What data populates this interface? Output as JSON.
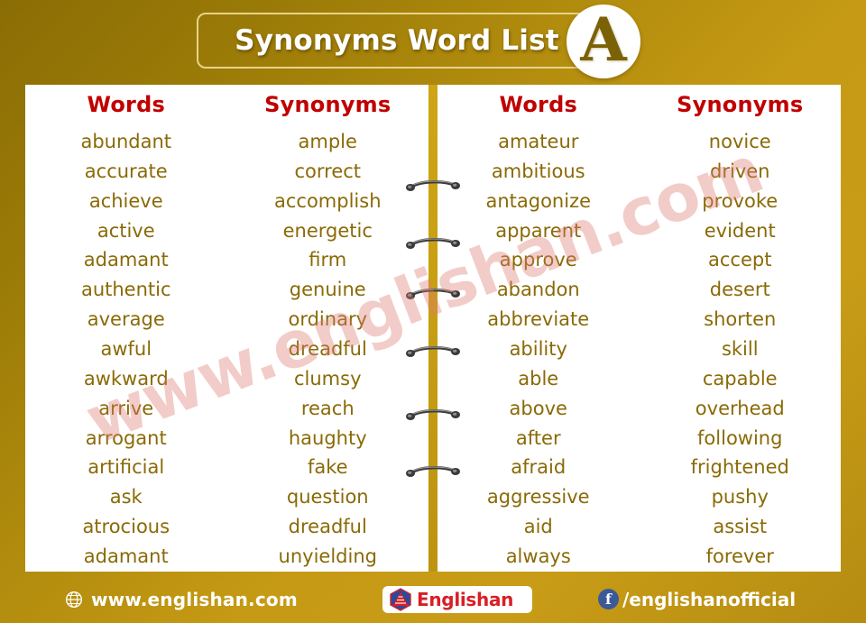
{
  "header": {
    "title": "Synonyms Word List",
    "letter_badge": "A"
  },
  "pages": [
    {
      "id": "left-page",
      "columns": [
        {
          "header": "Words",
          "items": [
            "abundant",
            "accurate",
            "achieve",
            "active",
            "adamant",
            "authentic",
            "average",
            "awful",
            "awkward",
            "arrive",
            "arrogant",
            "artificial",
            "ask",
            "atrocious",
            "adamant"
          ]
        },
        {
          "header": "Synonyms",
          "items": [
            "ample",
            "correct",
            "accomplish",
            "energetic",
            "firm",
            "genuine",
            "ordinary",
            "dreadful",
            "clumsy",
            "reach",
            "haughty",
            "fake",
            "question",
            "dreadful",
            "unyielding"
          ]
        }
      ]
    },
    {
      "id": "right-page",
      "columns": [
        {
          "header": "Words",
          "items": [
            "amateur",
            "ambitious",
            "antagonize",
            "apparent",
            "approve",
            "abandon",
            "abbreviate",
            "ability",
            "able",
            "above",
            "after",
            "afraid",
            "aggressive",
            "aid",
            "always"
          ]
        },
        {
          "header": "Synonyms",
          "items": [
            "novice",
            "driven",
            "provoke",
            "evident",
            "accept",
            "desert",
            "shorten",
            "skill",
            "capable",
            "overhead",
            "following",
            "frightened",
            "pushy",
            "assist",
            "forever"
          ]
        }
      ]
    }
  ],
  "watermark": {
    "text": "www.englishan.com"
  },
  "footer": {
    "website": "www.englishan.com",
    "logo_text": "Englishan",
    "facebook_handle": "/englishanofficial",
    "facebook_letter": "f"
  },
  "colors": {
    "background_dark": "#8a6d05",
    "background_light": "#c89c16",
    "heading_red": "#c10000",
    "word_gold": "#8a6a06",
    "white": "#ffffff",
    "logo_red": "#d81f26",
    "facebook_blue": "#3b5998",
    "watermark_pink": "#dc786e"
  }
}
